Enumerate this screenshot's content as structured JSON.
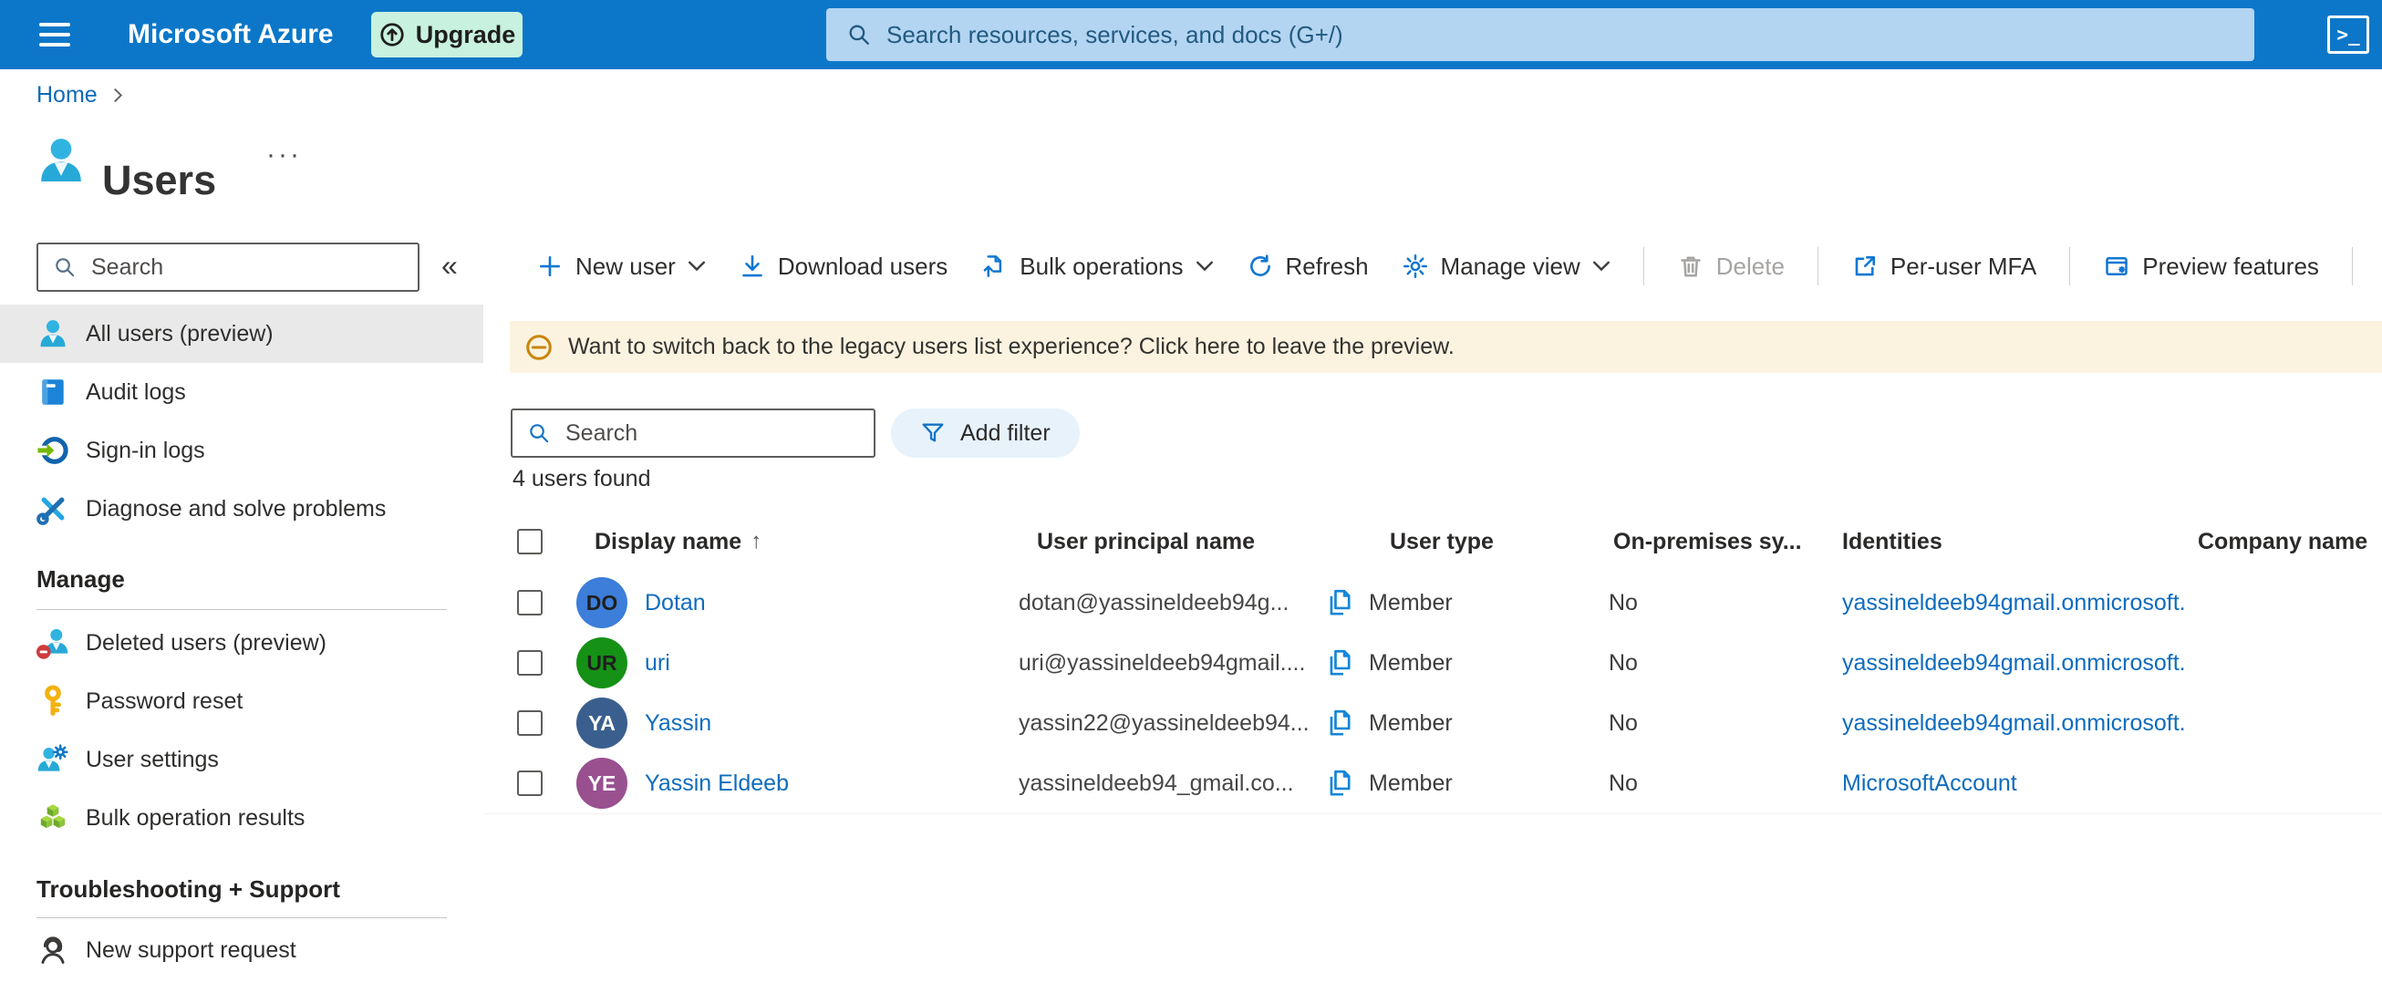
{
  "colors": {
    "accent": "#0078d4",
    "topbar_bg": "#0c77c8",
    "topbar_search_bg": "#b3d5f2",
    "upgrade_bg": "#c8f1df",
    "banner_bg": "#fbf3e0",
    "selected_item_bg": "#e9e9e9",
    "filter_pill_bg": "#e7f2fb",
    "link": "#0f6cbd"
  },
  "topbar": {
    "brand": "Microsoft Azure",
    "upgrade_label": "Upgrade",
    "search_placeholder": "Search resources, services, and docs (G+/)",
    "cloudshell_glyph": ">_"
  },
  "breadcrumb": {
    "home": "Home"
  },
  "page": {
    "title": "Users",
    "ellipsis": "···"
  },
  "sidebar": {
    "search_placeholder": "Search",
    "collapse_glyph": "«",
    "items": [
      {
        "label": "All users (preview)"
      },
      {
        "label": "Audit logs"
      },
      {
        "label": "Sign-in logs"
      },
      {
        "label": "Diagnose and solve problems"
      }
    ],
    "manage_header": "Manage",
    "manage_items": [
      {
        "label": "Deleted users (preview)"
      },
      {
        "label": "Password reset"
      },
      {
        "label": "User settings"
      },
      {
        "label": "Bulk operation results"
      }
    ],
    "support_header": "Troubleshooting + Support",
    "support_items": [
      {
        "label": "New support request"
      }
    ]
  },
  "toolbar": {
    "new_user": "New user",
    "download_users": "Download users",
    "bulk_operations": "Bulk operations",
    "refresh": "Refresh",
    "manage_view": "Manage view",
    "delete": "Delete",
    "per_user_mfa": "Per-user MFA",
    "preview_features": "Preview features"
  },
  "banner": {
    "message": "Want to switch back to the legacy users list experience? Click here to leave the preview."
  },
  "filter_bar": {
    "search_placeholder": "Search",
    "add_filter_label": "Add filter"
  },
  "results_count": "4 users found",
  "table": {
    "sort_glyph": "↑",
    "columns": {
      "display_name": "Display name",
      "upn": "User principal name",
      "user_type": "User type",
      "on_premises": "On-premises sy...",
      "identities": "Identities",
      "company": "Company name"
    },
    "rows": [
      {
        "initials": "DO",
        "avatar_bg": "#3c7ed9",
        "avatar_fg": "#1f1f1f",
        "display_name": "Dotan",
        "upn": "dotan@yassineldeeb94g...",
        "user_type": "Member",
        "on_premises": "No",
        "identities": "yassineldeeb94gmail.onmicrosoft.",
        "company": ""
      },
      {
        "initials": "UR",
        "avatar_bg": "#159115",
        "avatar_fg": "#1f1f1f",
        "display_name": "uri",
        "upn": "uri@yassineldeeb94gmail....",
        "user_type": "Member",
        "on_premises": "No",
        "identities": "yassineldeeb94gmail.onmicrosoft.",
        "company": ""
      },
      {
        "initials": "YA",
        "avatar_bg": "#3a5f8e",
        "avatar_fg": "#ffffff",
        "display_name": "Yassin",
        "upn": "yassin22@yassineldeeb94...",
        "user_type": "Member",
        "on_premises": "No",
        "identities": "yassineldeeb94gmail.onmicrosoft.",
        "company": ""
      },
      {
        "initials": "YE",
        "avatar_bg": "#99508f",
        "avatar_fg": "#ffffff",
        "display_name": "Yassin Eldeeb",
        "upn": "yassineldeeb94_gmail.co...",
        "user_type": "Member",
        "on_premises": "No",
        "identities": "MicrosoftAccount",
        "company": ""
      }
    ]
  }
}
